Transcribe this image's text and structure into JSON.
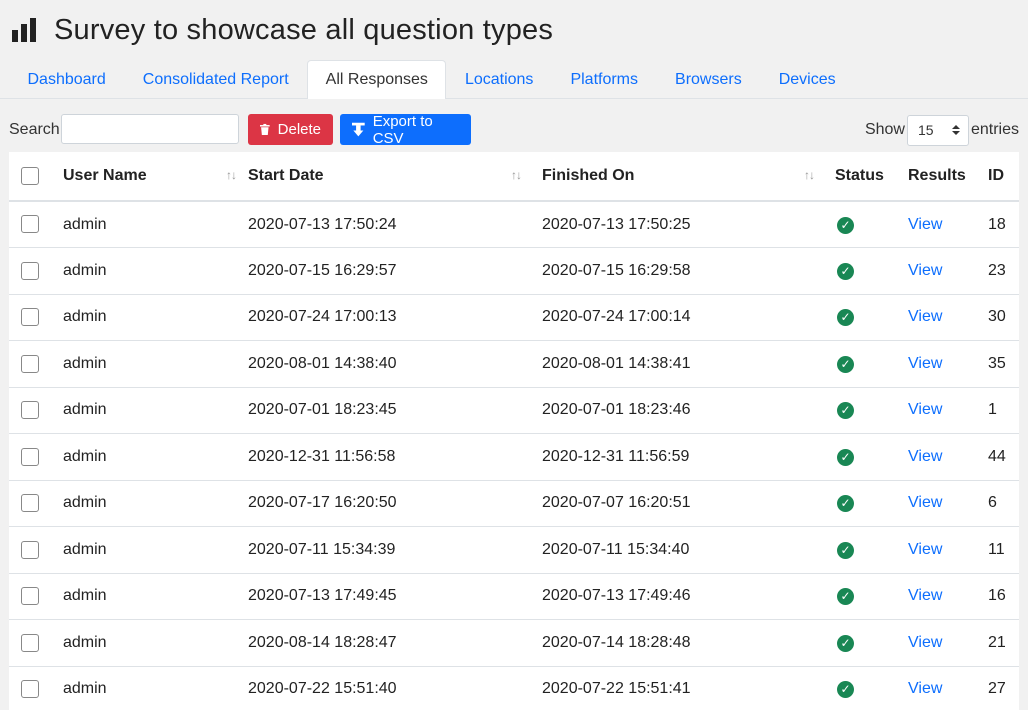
{
  "page": {
    "title": "Survey to showcase all question types"
  },
  "tabs": [
    {
      "label": "Dashboard",
      "active": false
    },
    {
      "label": "Consolidated Report",
      "active": false
    },
    {
      "label": "All Responses",
      "active": true
    },
    {
      "label": "Locations",
      "active": false
    },
    {
      "label": "Platforms",
      "active": false
    },
    {
      "label": "Browsers",
      "active": false
    },
    {
      "label": "Devices",
      "active": false
    }
  ],
  "toolbar": {
    "search_label": "Search:",
    "search_value": "",
    "delete_label": "Delete",
    "export_label": "Export to CSV",
    "show_label": "Show",
    "entries_value": "15",
    "entries_label": "entries"
  },
  "colors": {
    "accent": "#0d6efd",
    "danger": "#dc3545",
    "success": "#198754"
  },
  "table": {
    "headers": [
      "User Name",
      "Start Date",
      "Finished On",
      "Status",
      "Results",
      "ID"
    ],
    "rows": [
      {
        "user": "admin",
        "start": "2020-07-13 17:50:24",
        "finished": "2020-07-13 17:50:25",
        "status": "complete",
        "result": "View",
        "id": "18"
      },
      {
        "user": "admin",
        "start": "2020-07-15 16:29:57",
        "finished": "2020-07-15 16:29:58",
        "status": "complete",
        "result": "View",
        "id": "23"
      },
      {
        "user": "admin",
        "start": "2020-07-24 17:00:13",
        "finished": "2020-07-24 17:00:14",
        "status": "complete",
        "result": "View",
        "id": "30"
      },
      {
        "user": "admin",
        "start": "2020-08-01 14:38:40",
        "finished": "2020-08-01 14:38:41",
        "status": "complete",
        "result": "View",
        "id": "35"
      },
      {
        "user": "admin",
        "start": "2020-07-01 18:23:45",
        "finished": "2020-07-01 18:23:46",
        "status": "complete",
        "result": "View",
        "id": "1"
      },
      {
        "user": "admin",
        "start": "2020-12-31 11:56:58",
        "finished": "2020-12-31 11:56:59",
        "status": "complete",
        "result": "View",
        "id": "44"
      },
      {
        "user": "admin",
        "start": "2020-07-17 16:20:50",
        "finished": "2020-07-07 16:20:51",
        "status": "complete",
        "result": "View",
        "id": "6"
      },
      {
        "user": "admin",
        "start": "2020-07-11 15:34:39",
        "finished": "2020-07-11 15:34:40",
        "status": "complete",
        "result": "View",
        "id": "11"
      },
      {
        "user": "admin",
        "start": "2020-07-13 17:49:45",
        "finished": "2020-07-13 17:49:46",
        "status": "complete",
        "result": "View",
        "id": "16"
      },
      {
        "user": "admin",
        "start": "2020-08-14 18:28:47",
        "finished": "2020-07-14 18:28:48",
        "status": "complete",
        "result": "View",
        "id": "21"
      },
      {
        "user": "admin",
        "start": "2020-07-22 15:51:40",
        "finished": "2020-07-22 15:51:41",
        "status": "complete",
        "result": "View",
        "id": "27"
      }
    ]
  }
}
